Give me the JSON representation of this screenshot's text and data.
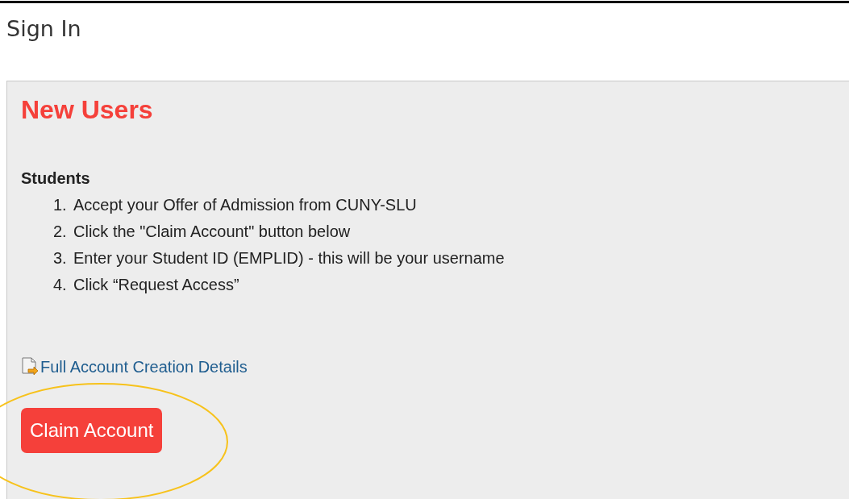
{
  "page_title": "Sign In",
  "panel": {
    "heading": "New Users",
    "section_label": "Students",
    "steps": [
      {
        "number": "1.",
        "text": "Accept your Offer of Admission from CUNY-SLU"
      },
      {
        "number": "2.",
        "text": "Click the \"Claim Account\" button below"
      },
      {
        "number": "3.",
        "text": "Enter your Student ID (EMPLID) - this will be your username"
      },
      {
        "number": "4.",
        "text": "Click “Request Access”"
      }
    ],
    "link": "Full Account Creation Details",
    "button": "Claim Account"
  }
}
